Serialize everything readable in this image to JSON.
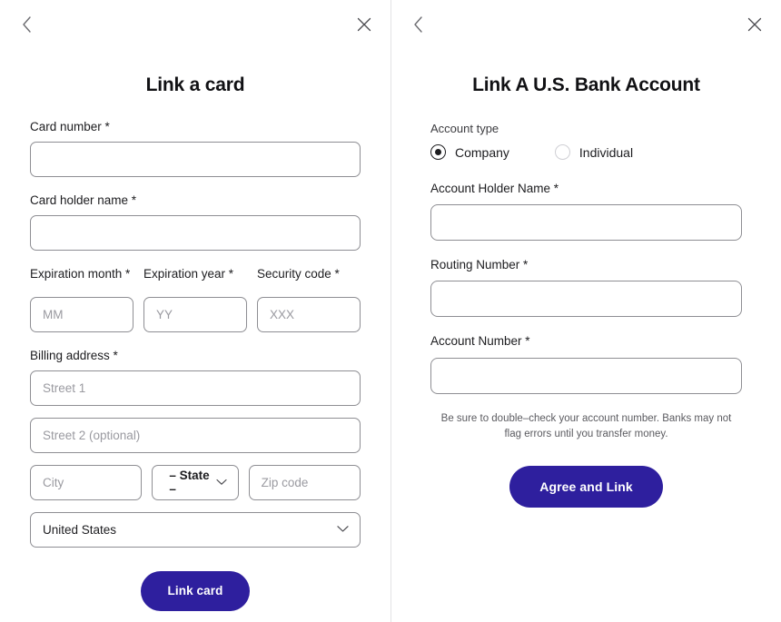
{
  "left_panel": {
    "back_icon": "chevron-left-icon",
    "close_icon": "close-icon",
    "title": "Link a card",
    "fields": {
      "card_number": {
        "label": "Card number *",
        "value": "",
        "placeholder": ""
      },
      "card_holder_name": {
        "label": "Card holder name *",
        "value": "",
        "placeholder": ""
      },
      "expiration_month": {
        "label": "Expiration month *",
        "value": "",
        "placeholder": "MM"
      },
      "expiration_year": {
        "label": "Expiration year *",
        "value": "",
        "placeholder": "YY"
      },
      "security_code": {
        "label": "Security code *",
        "value": "",
        "placeholder": "XXX"
      },
      "billing_address": {
        "label": "Billing address *"
      },
      "street1": {
        "value": "",
        "placeholder": "Street 1"
      },
      "street2": {
        "value": "",
        "placeholder": "Street 2 (optional)"
      },
      "city": {
        "value": "",
        "placeholder": "City"
      },
      "state": {
        "selected": "– State –",
        "options": [
          "– State –"
        ]
      },
      "zip": {
        "value": "",
        "placeholder": "Zip code"
      },
      "country": {
        "selected": "United States",
        "options": [
          "United States"
        ]
      }
    },
    "submit_label": "Link card"
  },
  "right_panel": {
    "back_icon": "chevron-left-icon",
    "close_icon": "close-icon",
    "title": "Link A U.S. Bank Account",
    "account_type": {
      "label": "Account type",
      "options": [
        {
          "label": "Company",
          "selected": true
        },
        {
          "label": "Individual",
          "selected": false
        }
      ]
    },
    "fields": {
      "account_holder_name": {
        "label": "Account Holder Name *",
        "value": "",
        "placeholder": ""
      },
      "routing_number": {
        "label": "Routing Number *",
        "value": "",
        "placeholder": ""
      },
      "account_number": {
        "label": "Account Number *",
        "value": "",
        "placeholder": ""
      }
    },
    "helper_text": "Be sure to double–check your account number. Banks may not flag errors until you transfer money.",
    "submit_label": "Agree and Link"
  },
  "colors": {
    "accent": "#2e1f9e",
    "text": "#1c1c1f",
    "border": "#8e8e93",
    "placeholder": "#9a9aa0",
    "divider": "#e3e3e5"
  }
}
